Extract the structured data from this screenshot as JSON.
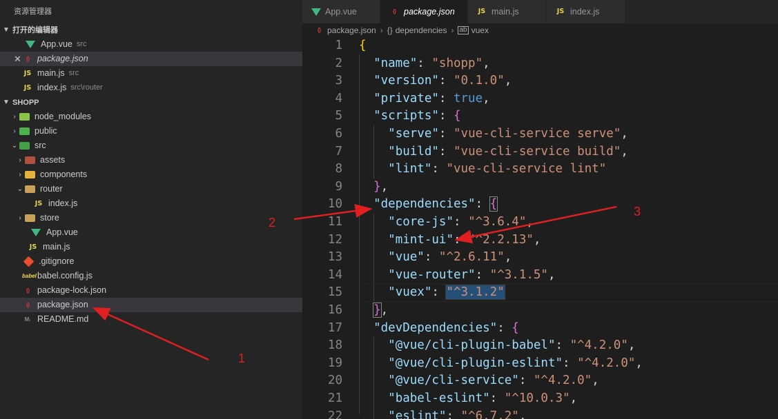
{
  "sidebar": {
    "title": "资源管理器",
    "open_editors_header": "打开的编辑器",
    "open_editors": [
      {
        "name": "App.vue",
        "desc": "src",
        "icon": "vue-icon"
      },
      {
        "name": "package.json",
        "desc": "",
        "icon": "json-icon"
      },
      {
        "name": "main.js",
        "desc": "src",
        "icon": "js-icon"
      },
      {
        "name": "index.js",
        "desc": "src\\router",
        "icon": "js-icon"
      }
    ],
    "project_header": "SHOPP",
    "tree": [
      {
        "name": "node_modules",
        "icon": "folder-icon"
      },
      {
        "name": "public",
        "icon": "folder-icon"
      },
      {
        "name": "src",
        "icon": "folder-icon"
      },
      {
        "name": "assets",
        "icon": "folder-icon"
      },
      {
        "name": "components",
        "icon": "folder-icon"
      },
      {
        "name": "router",
        "icon": "folder-icon"
      },
      {
        "name": "index.js",
        "icon": "js-icon"
      },
      {
        "name": "store",
        "icon": "folder-icon"
      },
      {
        "name": "App.vue",
        "icon": "vue-icon"
      },
      {
        "name": "main.js",
        "icon": "js-icon"
      },
      {
        "name": ".gitignore",
        "icon": "git-icon"
      },
      {
        "name": "babel.config.js",
        "icon": "babel-icon"
      },
      {
        "name": "package-lock.json",
        "icon": "json-icon"
      },
      {
        "name": "package.json",
        "icon": "json-icon"
      },
      {
        "name": "README.md",
        "icon": "md-icon"
      }
    ]
  },
  "tabs": [
    {
      "label": "App.vue",
      "icon": "vue-icon"
    },
    {
      "label": "package.json",
      "icon": "json-icon"
    },
    {
      "label": "main.js",
      "icon": "js-icon"
    },
    {
      "label": "index.js",
      "icon": "js-icon"
    }
  ],
  "breadcrumb": {
    "file": "package.json",
    "symbol": "dependencies",
    "leaf": "vuex"
  },
  "editor": {
    "line_numbers": [
      "1",
      "2",
      "3",
      "4",
      "5",
      "6",
      "7",
      "8",
      "9",
      "10",
      "11",
      "12",
      "13",
      "14",
      "15",
      "16",
      "17",
      "18",
      "19",
      "20",
      "21",
      "22"
    ],
    "code": {
      "name_key": "\"name\"",
      "name_val": "\"shopp\"",
      "version_key": "\"version\"",
      "version_val": "\"0.1.0\"",
      "private_key": "\"private\"",
      "private_val": "true",
      "scripts_key": "\"scripts\"",
      "serve_key": "\"serve\"",
      "serve_val": "\"vue-cli-service serve\"",
      "build_key": "\"build\"",
      "build_val": "\"vue-cli-service build\"",
      "lint_key": "\"lint\"",
      "lint_val": "\"vue-cli-service lint\"",
      "deps_key": "\"dependencies\"",
      "corejs_key": "\"core-js\"",
      "corejs_val": "\"^3.6.4\"",
      "mintui_key": "\"mint-ui\"",
      "mintui_val": "\"^2.2.13\"",
      "vue_key": "\"vue\"",
      "vue_val": "\"^2.6.11\"",
      "router_key": "\"vue-router\"",
      "router_val": "\"^3.1.5\"",
      "vuex_key": "\"vuex\"",
      "vuex_val": "\"^3.1.2\"",
      "devdeps_key": "\"devDependencies\"",
      "babel_key": "\"@vue/cli-plugin-babel\"",
      "babel_val": "\"^4.2.0\"",
      "eslintp_key": "\"@vue/cli-plugin-eslint\"",
      "eslintp_val": "\"^4.2.0\"",
      "clisvc_key": "\"@vue/cli-service\"",
      "clisvc_val": "\"^4.2.0\"",
      "babeleslint_key": "\"babel-eslint\"",
      "babeleslint_val": "\"^10.0.3\"",
      "eslint_key": "\"eslint\"",
      "eslint_val": "\"^6.7.2\""
    }
  },
  "annotations": [
    "1",
    "2",
    "3"
  ],
  "colors": {
    "annotation": "#e02020",
    "accent_vue": "#41b883",
    "js": "#e8d44d"
  }
}
